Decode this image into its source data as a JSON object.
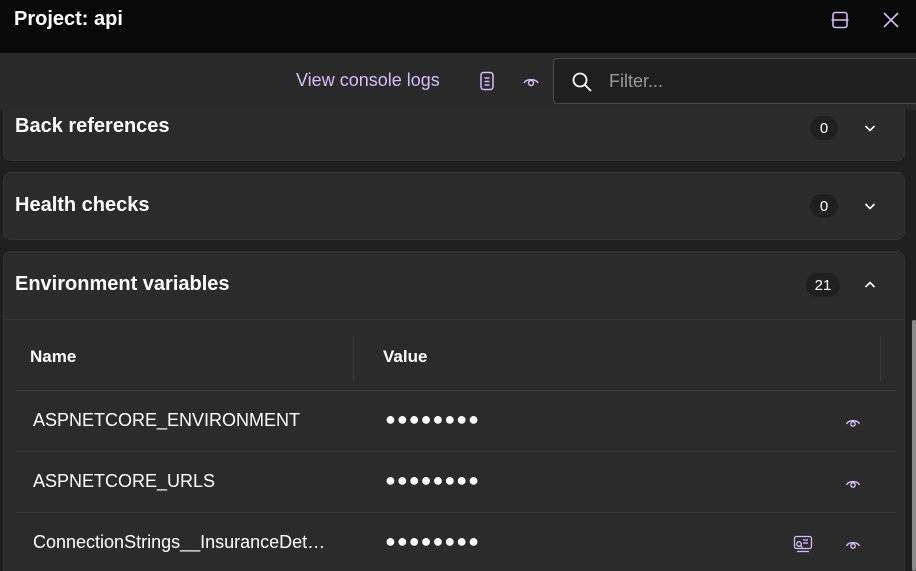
{
  "window": {
    "title": "Project: api"
  },
  "toolbar": {
    "console_link": "View console logs",
    "filter_placeholder": "Filter..."
  },
  "panels": [
    {
      "title": "Back references",
      "count": "0",
      "expanded": false
    },
    {
      "title": "Health checks",
      "count": "0",
      "expanded": false
    },
    {
      "title": "Environment variables",
      "count": "21",
      "expanded": true
    }
  ],
  "env_table": {
    "headers": {
      "name": "Name",
      "value": "Value"
    },
    "rows": [
      {
        "name": "ASPNETCORE_ENVIRONMENT",
        "value": "●●●●●●●●"
      },
      {
        "name": "ASPNETCORE_URLS",
        "value": "●●●●●●●●"
      },
      {
        "name": "ConnectionStrings__InsuranceDet…",
        "value": "●●●●●●●●"
      }
    ]
  },
  "colors": {
    "accent": "#d6bcfa",
    "background": "#1f1f1f",
    "panel": "#2b2b2b",
    "titlebar": "#090909"
  },
  "icons": [
    "restore-window-icon",
    "close-icon",
    "console-logs-icon",
    "eye-icon",
    "search-icon",
    "chevron-down-icon",
    "chevron-up-icon",
    "view-details-icon"
  ]
}
